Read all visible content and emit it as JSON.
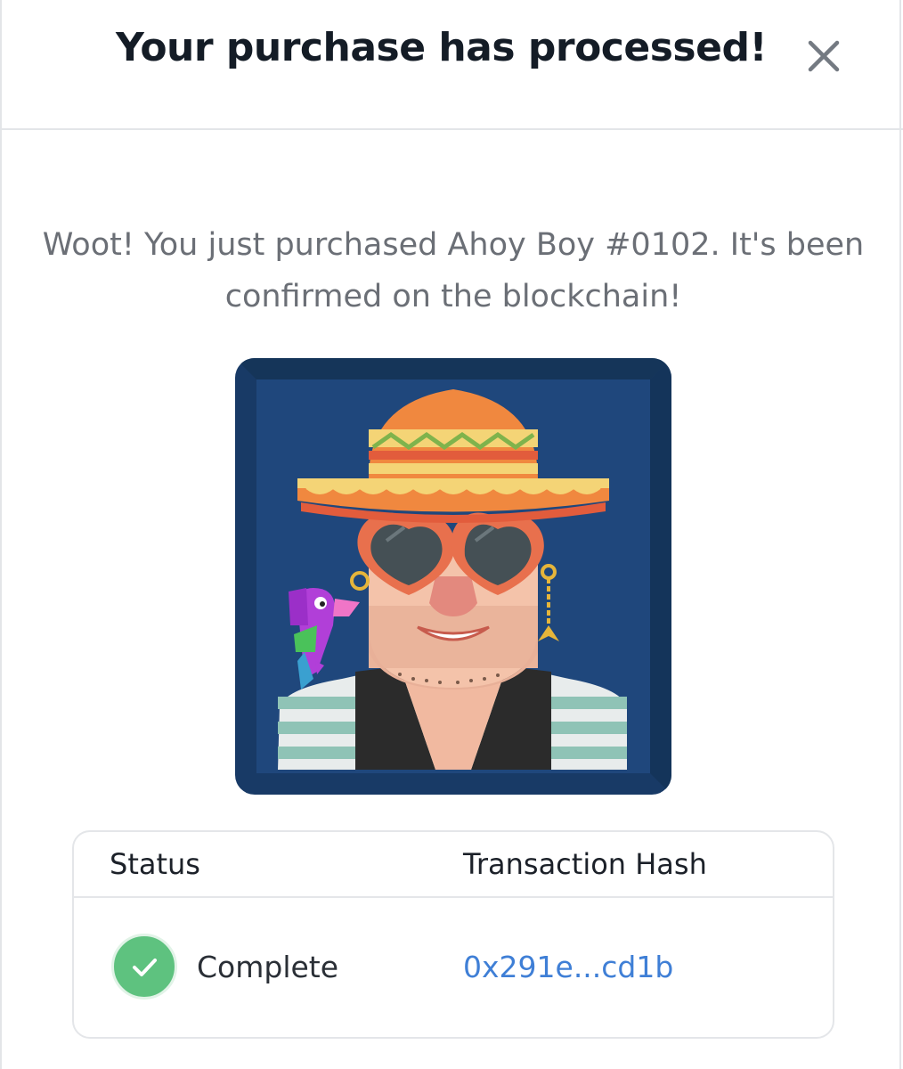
{
  "modal": {
    "title": "Your purchase has processed!",
    "close_icon": "close-icon",
    "message": "Woot! You just purchased Ahoy Boy #0102. It's been confirmed on the blockchain!"
  },
  "nft": {
    "image": "ahoy-boy-avatar",
    "background_color": "#1f477c"
  },
  "transaction": {
    "status_header": "Status",
    "hash_header": "Transaction Hash",
    "status_value": "Complete",
    "status_icon": "check-circle-icon",
    "status_color": "#5ec27f",
    "hash_value": "0x291e...cd1b",
    "link_color": "#3f7fd6"
  }
}
